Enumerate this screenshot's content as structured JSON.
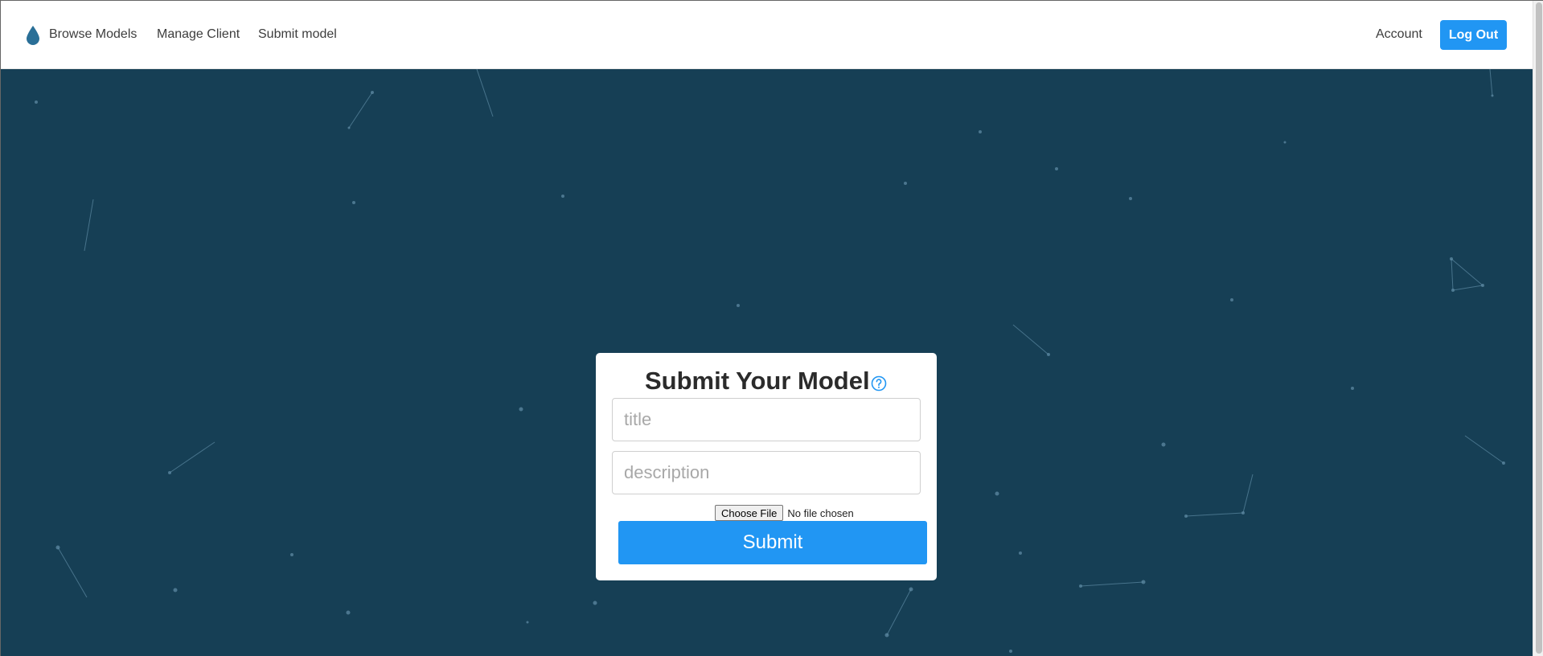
{
  "navbar": {
    "brand_icon": "water-drop-icon",
    "links": [
      {
        "label": "Browse Models"
      },
      {
        "label": "Manage Client"
      },
      {
        "label": "Submit model"
      }
    ],
    "account_label": "Account",
    "logout_label": "Log Out"
  },
  "form": {
    "title": "Submit Your Model",
    "help_icon": "question-circle-icon",
    "title_placeholder": "title",
    "description_placeholder": "description",
    "file_button_label": "Choose File",
    "file_status": "No file chosen",
    "submit_label": "Submit"
  },
  "colors": {
    "accent": "#2196f3",
    "hero_background": "#163f55",
    "brand_icon": "#2a6f97"
  }
}
